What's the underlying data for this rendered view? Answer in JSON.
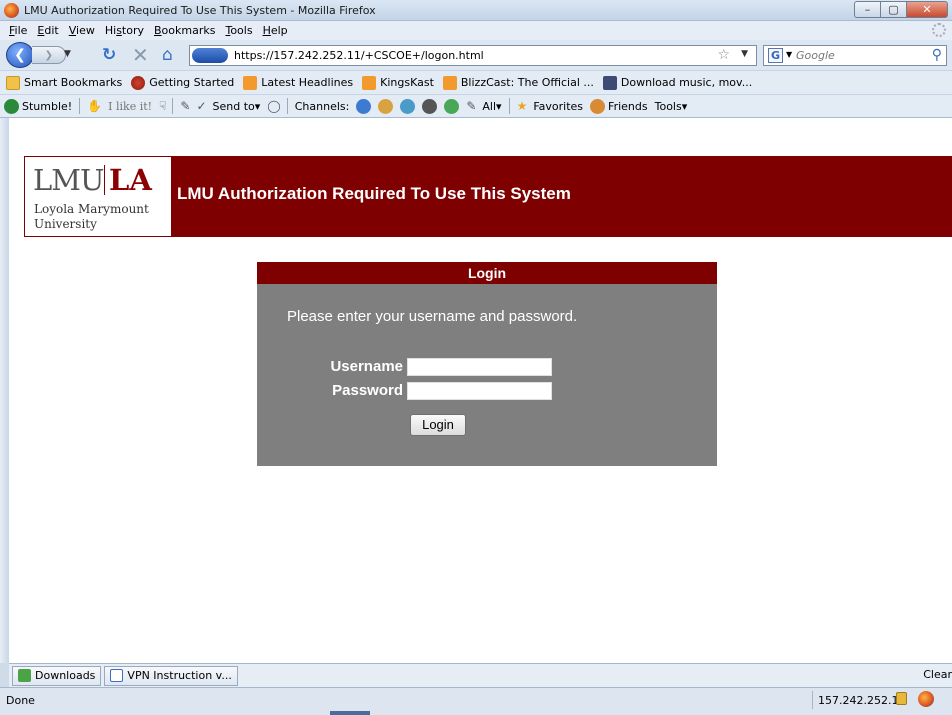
{
  "window": {
    "title": "LMU Authorization Required To Use This System - Mozilla Firefox",
    "minimize": "–",
    "maximize": "▢",
    "close": "✕"
  },
  "menu": [
    "File",
    "Edit",
    "View",
    "History",
    "Bookmarks",
    "Tools",
    "Help"
  ],
  "menu_underline": [
    "F",
    "E",
    "V",
    "s",
    "B",
    "T",
    "H"
  ],
  "nav": {
    "url": "https://157.242.252.11/+CSCOE+/logon.html",
    "search_placeholder": "Google",
    "search_engine_letter": "G"
  },
  "bookmarks": [
    {
      "label": "Smart Bookmarks",
      "icon": "folder-icon"
    },
    {
      "label": "Getting Started",
      "icon": "firefox-icon"
    },
    {
      "label": "Latest Headlines",
      "icon": "rss-icon"
    },
    {
      "label": "KingsKast",
      "icon": "rss-icon"
    },
    {
      "label": "BlizzCast: The Official ...",
      "icon": "rss-icon"
    },
    {
      "label": "Download music, mov...",
      "icon": "download-icon"
    }
  ],
  "stumble": {
    "stumble": "Stumble!",
    "like": "I like it!",
    "send_to": "Send to",
    "channels": "Channels:",
    "all": "All",
    "favorites": "Favorites",
    "friends": "Friends",
    "tools": "Tools"
  },
  "page": {
    "logo_lmu": "LMU",
    "logo_la": "LA",
    "logo_line1": "Loyola Marymount",
    "logo_line2": "University",
    "header_title": "LMU Authorization Required To Use This System",
    "login_heading": "Login",
    "prompt": "Please enter your username and password.",
    "username_label": "Username",
    "password_label": "Password",
    "username_value": "",
    "password_value": "",
    "login_button": "Login"
  },
  "downloads": {
    "downloads_tab": "Downloads",
    "doc_tab": "VPN Instruction v...",
    "clear": "Clear"
  },
  "status": {
    "text": "Done",
    "host": "157.242.252.11"
  },
  "colors": {
    "lmu_maroon": "#7f0000",
    "login_panel_gray": "#7f7f7f"
  }
}
